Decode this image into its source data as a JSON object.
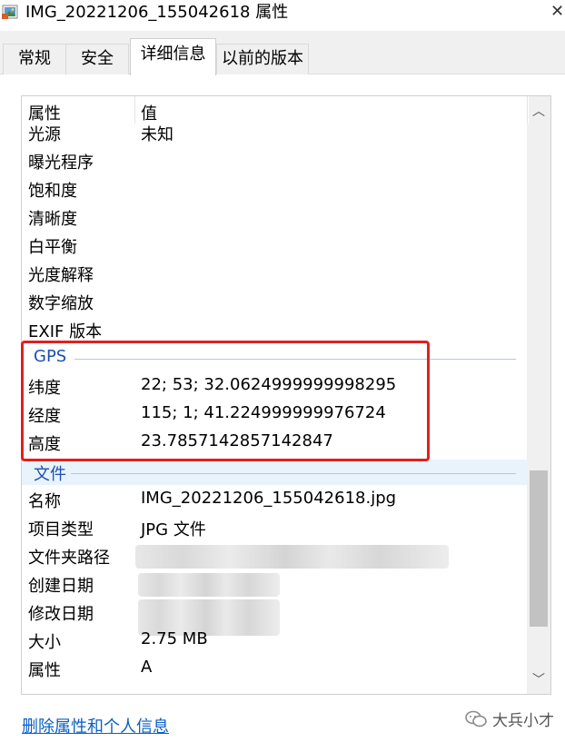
{
  "window": {
    "title": "IMG_20221206_155042618 属性",
    "close_icon": "close-icon",
    "app_icon": "photo-file-icon"
  },
  "tabs": [
    {
      "label": "常规",
      "active": false
    },
    {
      "label": "安全",
      "active": false
    },
    {
      "label": "详细信息",
      "active": true
    },
    {
      "label": "以前的版本",
      "active": false
    }
  ],
  "list": {
    "header": {
      "property": "属性",
      "value": "值"
    },
    "rows_top": [
      {
        "key": "光源",
        "value": "未知"
      },
      {
        "key": "曝光程序",
        "value": ""
      },
      {
        "key": "饱和度",
        "value": ""
      },
      {
        "key": "清晰度",
        "value": ""
      },
      {
        "key": "白平衡",
        "value": ""
      },
      {
        "key": "光度解释",
        "value": ""
      },
      {
        "key": "数字缩放",
        "value": ""
      },
      {
        "key": "EXIF 版本",
        "value": ""
      }
    ],
    "gps_group": "GPS",
    "gps_rows": [
      {
        "key": "纬度",
        "value": "22; 53; 32.0624999999998295"
      },
      {
        "key": "经度",
        "value": "115; 1; 41.224999999976724"
      },
      {
        "key": "高度",
        "value": "23.7857142857142847"
      }
    ],
    "file_group": "文件",
    "file_rows": [
      {
        "key": "名称",
        "value": "IMG_20221206_155042618.jpg"
      },
      {
        "key": "项目类型",
        "value": "JPG 文件"
      },
      {
        "key": "文件夹路径",
        "value": ""
      },
      {
        "key": "创建日期",
        "value": ""
      },
      {
        "key": "修改日期",
        "value": ""
      },
      {
        "key": "大小",
        "value": "2.75 MB"
      },
      {
        "key": "属性",
        "value": "A"
      }
    ]
  },
  "footer": {
    "link": "删除属性和个人信息",
    "watermark": "大兵小才"
  },
  "colors": {
    "highlight_box": "#e02020",
    "group_header": "#1e4fb0",
    "link": "#0a5fc4"
  }
}
